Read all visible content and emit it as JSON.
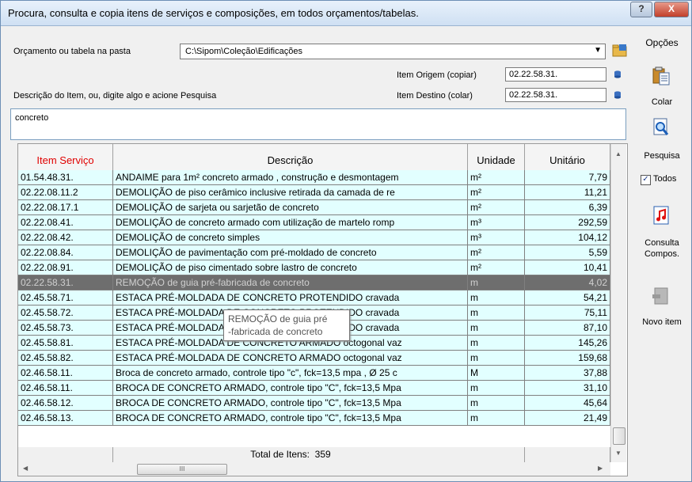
{
  "window": {
    "title": "Procura, consulta e copia itens de serviços e composições, em todos orçamentos/tabelas.",
    "help_label": "?",
    "close_label": "X"
  },
  "form": {
    "folder_label": "Orçamento ou tabela na pasta",
    "folder_value": "C:\\Sipom\\Coleção\\Edificações",
    "origin_label": "Item Origem (copiar)",
    "origin_value": "02.22.58.31.",
    "dest_label": "Item Destino (colar)",
    "dest_value": "02.22.58.31.",
    "desc_label": "Descrição do Item, ou, digite algo e acione Pesquisa",
    "search_value": "concreto"
  },
  "grid": {
    "headers": [
      "Item Serviço",
      "Descrição",
      "Unidade",
      "Unitário"
    ],
    "header_item_color": "#e00000",
    "rows": [
      {
        "item": "01.54.48.31.",
        "desc": "ANDAIME para 1m² concreto armado , construção e desmontagem",
        "unit": "m²",
        "price": "7,79"
      },
      {
        "item": "02.22.08.11.2",
        "desc": "DEMOLIÇÃO de piso cerâmico inclusive retirada da camada de re",
        "unit": "m²",
        "price": "11,21"
      },
      {
        "item": "02.22.08.17.1",
        "desc": "DEMOLIÇÃO de sarjeta ou sarjetão de concreto",
        "unit": "m²",
        "price": "6,39"
      },
      {
        "item": "02.22.08.41.",
        "desc": "DEMOLIÇÃO de concreto armado com utilização de martelo romp",
        "unit": "m³",
        "price": "292,59"
      },
      {
        "item": "02.22.08.42.",
        "desc": "DEMOLIÇÃO de concreto simples",
        "unit": "m³",
        "price": "104,12"
      },
      {
        "item": "02.22.08.84.",
        "desc": "DEMOLIÇÃO de pavimentação com pré-moldado de concreto",
        "unit": "m²",
        "price": "5,59"
      },
      {
        "item": "02.22.08.91.",
        "desc": "DEMOLIÇÃO de piso cimentado sobre lastro de concreto",
        "unit": "m²",
        "price": "10,41"
      },
      {
        "item": "02.22.58.31.",
        "desc": "REMOÇÃO de guia pré-fabricada de concreto",
        "unit": "m",
        "price": "4,02",
        "selected": true
      },
      {
        "item": "02.45.58.71.",
        "desc": "ESTACA PRÉ-MOLDADA DE CONCRETO PROTENDIDO cravada",
        "unit": "m",
        "price": "54,21"
      },
      {
        "item": "02.45.58.72.",
        "desc": "ESTACA PRÉ-MOLDADA DE CONCRETO PROTENDIDO cravada",
        "unit": "m",
        "price": "75,11"
      },
      {
        "item": "02.45.58.73.",
        "desc": "ESTACA PRÉ-MOLDADA DE CONCRETO PROTENDIDO cravada",
        "unit": "m",
        "price": "87,10"
      },
      {
        "item": "02.45.58.81.",
        "desc": "ESTACA PRÉ-MOLDADA DE CONCRETO ARMADO octogonal vaz",
        "unit": "m",
        "price": "145,26"
      },
      {
        "item": "02.45.58.82.",
        "desc": "ESTACA PRÉ-MOLDADA DE CONCRETO ARMADO octogonal vaz",
        "unit": "m",
        "price": "159,68"
      },
      {
        "item": "02.46.58.11.",
        "desc": "Broca de concreto armado, controle tipo \"c\", fck=13,5 mpa , Ø 25 c",
        "unit": "M",
        "price": "37,88"
      },
      {
        "item": "02.46.58.11.",
        "desc": "BROCA DE CONCRETO ARMADO, controle tipo \"C\", fck=13,5 Mpa",
        "unit": "m",
        "price": "31,10"
      },
      {
        "item": "02.46.58.12.",
        "desc": "BROCA DE CONCRETO ARMADO, controle tipo \"C\", fck=13,5 Mpa",
        "unit": "m",
        "price": "45,64"
      },
      {
        "item": "02.46.58.13.",
        "desc": "BROCA DE CONCRETO ARMADO, controle tipo \"C\", fck=13,5 Mpa",
        "unit": "m",
        "price": "21,49"
      }
    ],
    "total_label": "Total de Itens:",
    "total_value": "359",
    "hscroll_grip": "III",
    "tooltip_line1": "REMOÇÃO de guia pré",
    "tooltip_line2": "-fabricada de concreto"
  },
  "sidebar": {
    "options_label": "Opções",
    "paste_label": "Colar",
    "search_label": "Pesquisa",
    "all_label": "Todos",
    "all_checked": true,
    "consult_label_1": "Consulta",
    "consult_label_2": "Compos.",
    "new_item_label": "Novo item"
  }
}
